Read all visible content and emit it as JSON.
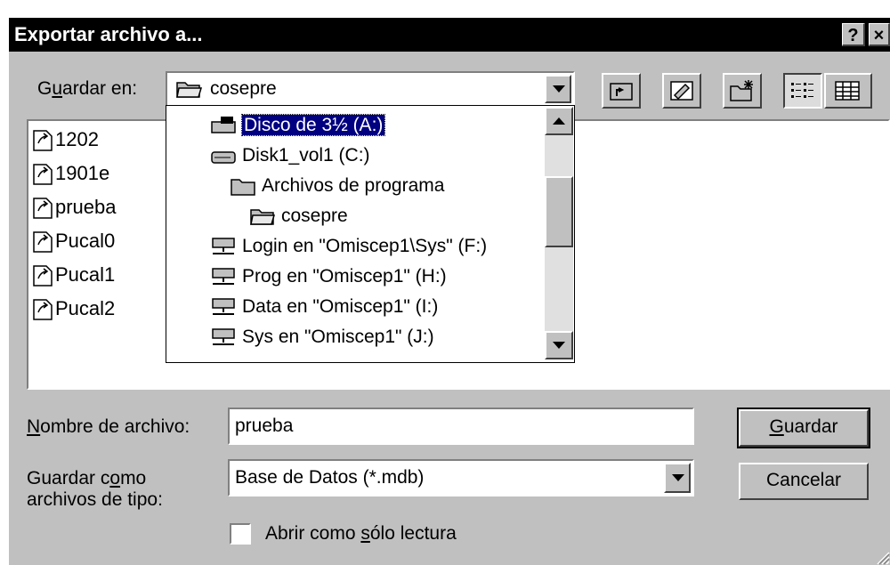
{
  "window": {
    "title": "Exportar archivo a...",
    "help_button": "?",
    "close_button": "×"
  },
  "save_in": {
    "label": "Guardar en:",
    "value": "cosepre"
  },
  "file_list": [
    {
      "name": "1202"
    },
    {
      "name": "1901e"
    },
    {
      "name": "prueba"
    },
    {
      "name": "Pucal0"
    },
    {
      "name": "Pucal1"
    },
    {
      "name": "Pucal2"
    }
  ],
  "dropdown": {
    "items": [
      {
        "label": "Disco de 3½ (A:)",
        "icon": "floppy-drive-icon",
        "selected": true
      },
      {
        "label": "Disk1_vol1 (C:)",
        "icon": "hard-drive-icon"
      },
      {
        "label": "Archivos de programa",
        "icon": "folder-icon"
      },
      {
        "label": "cosepre",
        "icon": "open-folder-icon"
      },
      {
        "label": "Login en \"Omiscep1\\Sys\" (F:)",
        "icon": "network-drive-icon"
      },
      {
        "label": "Prog en \"Omiscep1\" (H:)",
        "icon": "network-drive-icon"
      },
      {
        "label": "Data en \"Omiscep1\" (I:)",
        "icon": "network-drive-icon"
      },
      {
        "label": "Sys en \"Omiscep1\" (J:)",
        "icon": "network-drive-icon"
      }
    ]
  },
  "filename": {
    "label": "Nombre de archivo:",
    "value": "prueba"
  },
  "filetype": {
    "label_line1": "Guardar como",
    "label_line2": "archivos de tipo:",
    "value": "Base de Datos  (*.mdb)"
  },
  "readonly": {
    "label": "Abrir como sólo lectura",
    "checked": false
  },
  "buttons": {
    "save": "Guardar",
    "cancel": "Cancelar"
  },
  "colors": {
    "face": "#c0c0c0",
    "titlebar": "#000000",
    "selection": "#000080"
  }
}
